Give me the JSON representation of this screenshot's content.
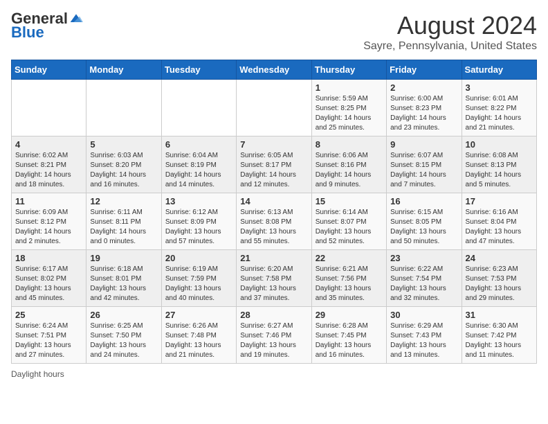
{
  "logo": {
    "general": "General",
    "blue": "Blue"
  },
  "title": "August 2024",
  "subtitle": "Sayre, Pennsylvania, United States",
  "days_of_week": [
    "Sunday",
    "Monday",
    "Tuesday",
    "Wednesday",
    "Thursday",
    "Friday",
    "Saturday"
  ],
  "legend_label": "Daylight hours",
  "weeks": [
    [
      {
        "day": "",
        "info": ""
      },
      {
        "day": "",
        "info": ""
      },
      {
        "day": "",
        "info": ""
      },
      {
        "day": "",
        "info": ""
      },
      {
        "day": "1",
        "info": "Sunrise: 5:59 AM\nSunset: 8:25 PM\nDaylight: 14 hours and 25 minutes."
      },
      {
        "day": "2",
        "info": "Sunrise: 6:00 AM\nSunset: 8:23 PM\nDaylight: 14 hours and 23 minutes."
      },
      {
        "day": "3",
        "info": "Sunrise: 6:01 AM\nSunset: 8:22 PM\nDaylight: 14 hours and 21 minutes."
      }
    ],
    [
      {
        "day": "4",
        "info": "Sunrise: 6:02 AM\nSunset: 8:21 PM\nDaylight: 14 hours and 18 minutes."
      },
      {
        "day": "5",
        "info": "Sunrise: 6:03 AM\nSunset: 8:20 PM\nDaylight: 14 hours and 16 minutes."
      },
      {
        "day": "6",
        "info": "Sunrise: 6:04 AM\nSunset: 8:19 PM\nDaylight: 14 hours and 14 minutes."
      },
      {
        "day": "7",
        "info": "Sunrise: 6:05 AM\nSunset: 8:17 PM\nDaylight: 14 hours and 12 minutes."
      },
      {
        "day": "8",
        "info": "Sunrise: 6:06 AM\nSunset: 8:16 PM\nDaylight: 14 hours and 9 minutes."
      },
      {
        "day": "9",
        "info": "Sunrise: 6:07 AM\nSunset: 8:15 PM\nDaylight: 14 hours and 7 minutes."
      },
      {
        "day": "10",
        "info": "Sunrise: 6:08 AM\nSunset: 8:13 PM\nDaylight: 14 hours and 5 minutes."
      }
    ],
    [
      {
        "day": "11",
        "info": "Sunrise: 6:09 AM\nSunset: 8:12 PM\nDaylight: 14 hours and 2 minutes."
      },
      {
        "day": "12",
        "info": "Sunrise: 6:11 AM\nSunset: 8:11 PM\nDaylight: 14 hours and 0 minutes."
      },
      {
        "day": "13",
        "info": "Sunrise: 6:12 AM\nSunset: 8:09 PM\nDaylight: 13 hours and 57 minutes."
      },
      {
        "day": "14",
        "info": "Sunrise: 6:13 AM\nSunset: 8:08 PM\nDaylight: 13 hours and 55 minutes."
      },
      {
        "day": "15",
        "info": "Sunrise: 6:14 AM\nSunset: 8:07 PM\nDaylight: 13 hours and 52 minutes."
      },
      {
        "day": "16",
        "info": "Sunrise: 6:15 AM\nSunset: 8:05 PM\nDaylight: 13 hours and 50 minutes."
      },
      {
        "day": "17",
        "info": "Sunrise: 6:16 AM\nSunset: 8:04 PM\nDaylight: 13 hours and 47 minutes."
      }
    ],
    [
      {
        "day": "18",
        "info": "Sunrise: 6:17 AM\nSunset: 8:02 PM\nDaylight: 13 hours and 45 minutes."
      },
      {
        "day": "19",
        "info": "Sunrise: 6:18 AM\nSunset: 8:01 PM\nDaylight: 13 hours and 42 minutes."
      },
      {
        "day": "20",
        "info": "Sunrise: 6:19 AM\nSunset: 7:59 PM\nDaylight: 13 hours and 40 minutes."
      },
      {
        "day": "21",
        "info": "Sunrise: 6:20 AM\nSunset: 7:58 PM\nDaylight: 13 hours and 37 minutes."
      },
      {
        "day": "22",
        "info": "Sunrise: 6:21 AM\nSunset: 7:56 PM\nDaylight: 13 hours and 35 minutes."
      },
      {
        "day": "23",
        "info": "Sunrise: 6:22 AM\nSunset: 7:54 PM\nDaylight: 13 hours and 32 minutes."
      },
      {
        "day": "24",
        "info": "Sunrise: 6:23 AM\nSunset: 7:53 PM\nDaylight: 13 hours and 29 minutes."
      }
    ],
    [
      {
        "day": "25",
        "info": "Sunrise: 6:24 AM\nSunset: 7:51 PM\nDaylight: 13 hours and 27 minutes."
      },
      {
        "day": "26",
        "info": "Sunrise: 6:25 AM\nSunset: 7:50 PM\nDaylight: 13 hours and 24 minutes."
      },
      {
        "day": "27",
        "info": "Sunrise: 6:26 AM\nSunset: 7:48 PM\nDaylight: 13 hours and 21 minutes."
      },
      {
        "day": "28",
        "info": "Sunrise: 6:27 AM\nSunset: 7:46 PM\nDaylight: 13 hours and 19 minutes."
      },
      {
        "day": "29",
        "info": "Sunrise: 6:28 AM\nSunset: 7:45 PM\nDaylight: 13 hours and 16 minutes."
      },
      {
        "day": "30",
        "info": "Sunrise: 6:29 AM\nSunset: 7:43 PM\nDaylight: 13 hours and 13 minutes."
      },
      {
        "day": "31",
        "info": "Sunrise: 6:30 AM\nSunset: 7:42 PM\nDaylight: 13 hours and 11 minutes."
      }
    ]
  ]
}
